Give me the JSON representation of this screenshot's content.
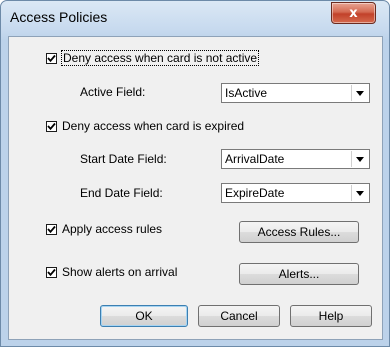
{
  "window": {
    "title": "Access Policies",
    "close_glyph": "x"
  },
  "deny_inactive": {
    "label": "Deny access when card is not active",
    "checked": true
  },
  "active_field": {
    "label": "Active Field:",
    "value": "IsActive"
  },
  "deny_expired": {
    "label": "Deny access when card is expired",
    "checked": true
  },
  "start_date": {
    "label": "Start Date Field:",
    "value": "ArrivalDate"
  },
  "end_date": {
    "label": "End Date Field:",
    "value": "ExpireDate"
  },
  "apply_rules": {
    "label": "Apply access rules",
    "checked": true,
    "button": "Access Rules..."
  },
  "show_alerts": {
    "label": "Show alerts on arrival",
    "checked": true,
    "button": "Alerts..."
  },
  "footer": {
    "ok": "OK",
    "cancel": "Cancel",
    "help": "Help"
  }
}
